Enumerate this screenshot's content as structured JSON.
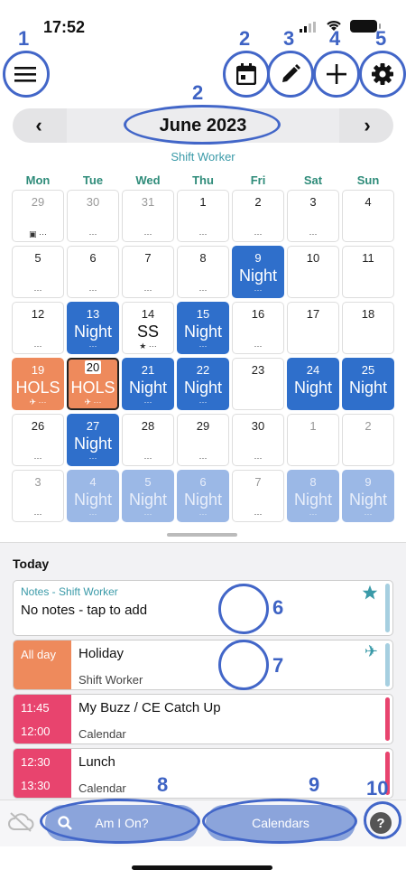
{
  "status": {
    "time": "17:52"
  },
  "header": {
    "annotations": [
      "1",
      "2",
      "3",
      "4",
      "5"
    ],
    "month_annotation": "2",
    "month": "June 2023",
    "prev": "‹",
    "next": "›",
    "subtitle": "Shift Worker"
  },
  "weekdays": [
    "Mon",
    "Tue",
    "Wed",
    "Thu",
    "Fri",
    "Sat",
    "Sun"
  ],
  "weeks": [
    [
      {
        "d": "29",
        "f": true,
        "dots": "▣ ···"
      },
      {
        "d": "30",
        "f": true,
        "dots": "···"
      },
      {
        "d": "31",
        "f": true,
        "dots": "···"
      },
      {
        "d": "1",
        "dots": "···"
      },
      {
        "d": "2",
        "dots": "···"
      },
      {
        "d": "3",
        "dots": "···"
      },
      {
        "d": "4"
      }
    ],
    [
      {
        "d": "5",
        "dots": "···"
      },
      {
        "d": "6",
        "dots": "···"
      },
      {
        "d": "7",
        "dots": "···"
      },
      {
        "d": "8",
        "dots": "···"
      },
      {
        "d": "9",
        "t": "night",
        "lbl": "Night",
        "dots": "···"
      },
      {
        "d": "10"
      },
      {
        "d": "11"
      }
    ],
    [
      {
        "d": "12",
        "dots": "···"
      },
      {
        "d": "13",
        "t": "night",
        "lbl": "Night",
        "dots": "···"
      },
      {
        "d": "14",
        "lbl": "SS",
        "dots": "★ ···"
      },
      {
        "d": "15",
        "t": "night",
        "lbl": "Night",
        "dots": "···"
      },
      {
        "d": "16",
        "dots": "···"
      },
      {
        "d": "17"
      },
      {
        "d": "18"
      }
    ],
    [
      {
        "d": "19",
        "t": "hols",
        "lbl": "HOLS",
        "dots": "✈ ···"
      },
      {
        "d": "20",
        "t": "hols",
        "today": true,
        "lbl": "HOLS",
        "dots": "✈ ···"
      },
      {
        "d": "21",
        "t": "night",
        "lbl": "Night",
        "dots": "···"
      },
      {
        "d": "22",
        "t": "night",
        "lbl": "Night",
        "dots": "···"
      },
      {
        "d": "23"
      },
      {
        "d": "24",
        "t": "night",
        "lbl": "Night"
      },
      {
        "d": "25",
        "t": "night",
        "lbl": "Night"
      }
    ],
    [
      {
        "d": "26",
        "dots": "···"
      },
      {
        "d": "27",
        "t": "night",
        "lbl": "Night",
        "dots": "···"
      },
      {
        "d": "28",
        "dots": "···"
      },
      {
        "d": "29",
        "dots": "···"
      },
      {
        "d": "30",
        "dots": "···"
      },
      {
        "d": "1",
        "f": true
      },
      {
        "d": "2",
        "f": true
      }
    ],
    [
      {
        "d": "3",
        "f": true,
        "dots": "···"
      },
      {
        "d": "4",
        "f": true,
        "t": "nightfade",
        "lbl": "Night",
        "dots": "···"
      },
      {
        "d": "5",
        "f": true,
        "t": "nightfade",
        "lbl": "Night",
        "dots": "···"
      },
      {
        "d": "6",
        "f": true,
        "t": "nightfade",
        "lbl": "Night",
        "dots": "···"
      },
      {
        "d": "7",
        "f": true,
        "dots": "···"
      },
      {
        "d": "8",
        "f": true,
        "t": "nightfade",
        "lbl": "Night",
        "dots": "···"
      },
      {
        "d": "9",
        "f": true,
        "t": "nightfade",
        "lbl": "Night",
        "dots": "···"
      }
    ]
  ],
  "today": {
    "heading": "Today",
    "notes_label": "Notes - Shift Worker",
    "notes_text": "No notes - tap to add",
    "annot6": "6",
    "annot7": "7",
    "events": [
      {
        "start": "All day",
        "end": "",
        "title": "Holiday",
        "cal": "Shift Worker",
        "color": "#ee8a5c",
        "bar": "#a6cfe0",
        "icon": "✈"
      },
      {
        "start": "11:45",
        "end": "12:00",
        "title": "My Buzz / CE Catch Up",
        "cal": "Calendar",
        "color": "#e8446e",
        "bar": "#e8446e",
        "icon": ""
      },
      {
        "start": "12:30",
        "end": "13:30",
        "title": "Lunch",
        "cal": "Calendar",
        "color": "#e8446e",
        "bar": "#e8446e",
        "icon": ""
      }
    ]
  },
  "bottom": {
    "search_label": "Am I On?",
    "calendars_label": "Calendars",
    "help": "?",
    "annotations": [
      "8",
      "9",
      "10"
    ]
  },
  "colors": {
    "accent": "#3e63c4",
    "night": "#2f6fcb",
    "hols": "#ee8a5c",
    "teal": "#3a9aa8",
    "pink": "#e8446e"
  }
}
